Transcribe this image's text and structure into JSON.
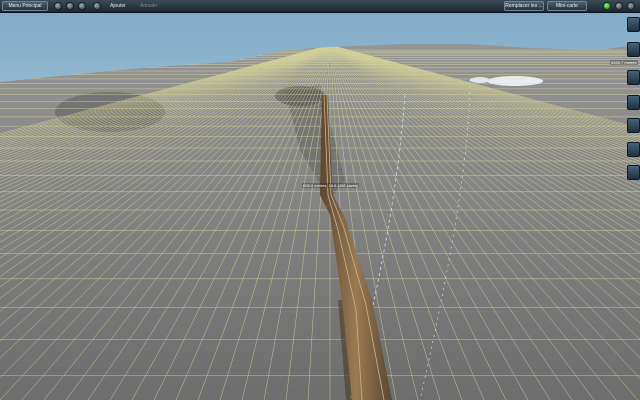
{
  "toolbar": {
    "main_menu_label": "Menu Principal",
    "add_label": "Ajouter",
    "disabled_label": "Annuler",
    "replace_label": "Remplacer les ...",
    "minimap_label": "Mini-carte"
  },
  "scene": {
    "label_near": "606.0 metres, 18.8 (408 saves)",
    "label_far": "5026.7 metres"
  },
  "colors": {
    "sky_top": "#7ea9c7",
    "sky_horizon": "#d6e6ef",
    "terrain": "#7b7b7b",
    "grid": "#e6e49a",
    "track": "#8a6a45",
    "toolbar": "#1c2630",
    "status_green": "#3fbf2a"
  },
  "icons": {
    "side_tools": [
      "track-tool-icon",
      "tree-tool-icon",
      "vehicle-tool-icon",
      "object-tool-icon",
      "driver-tool-icon",
      "rail-tool-icon",
      "settings-tool-icon"
    ]
  }
}
